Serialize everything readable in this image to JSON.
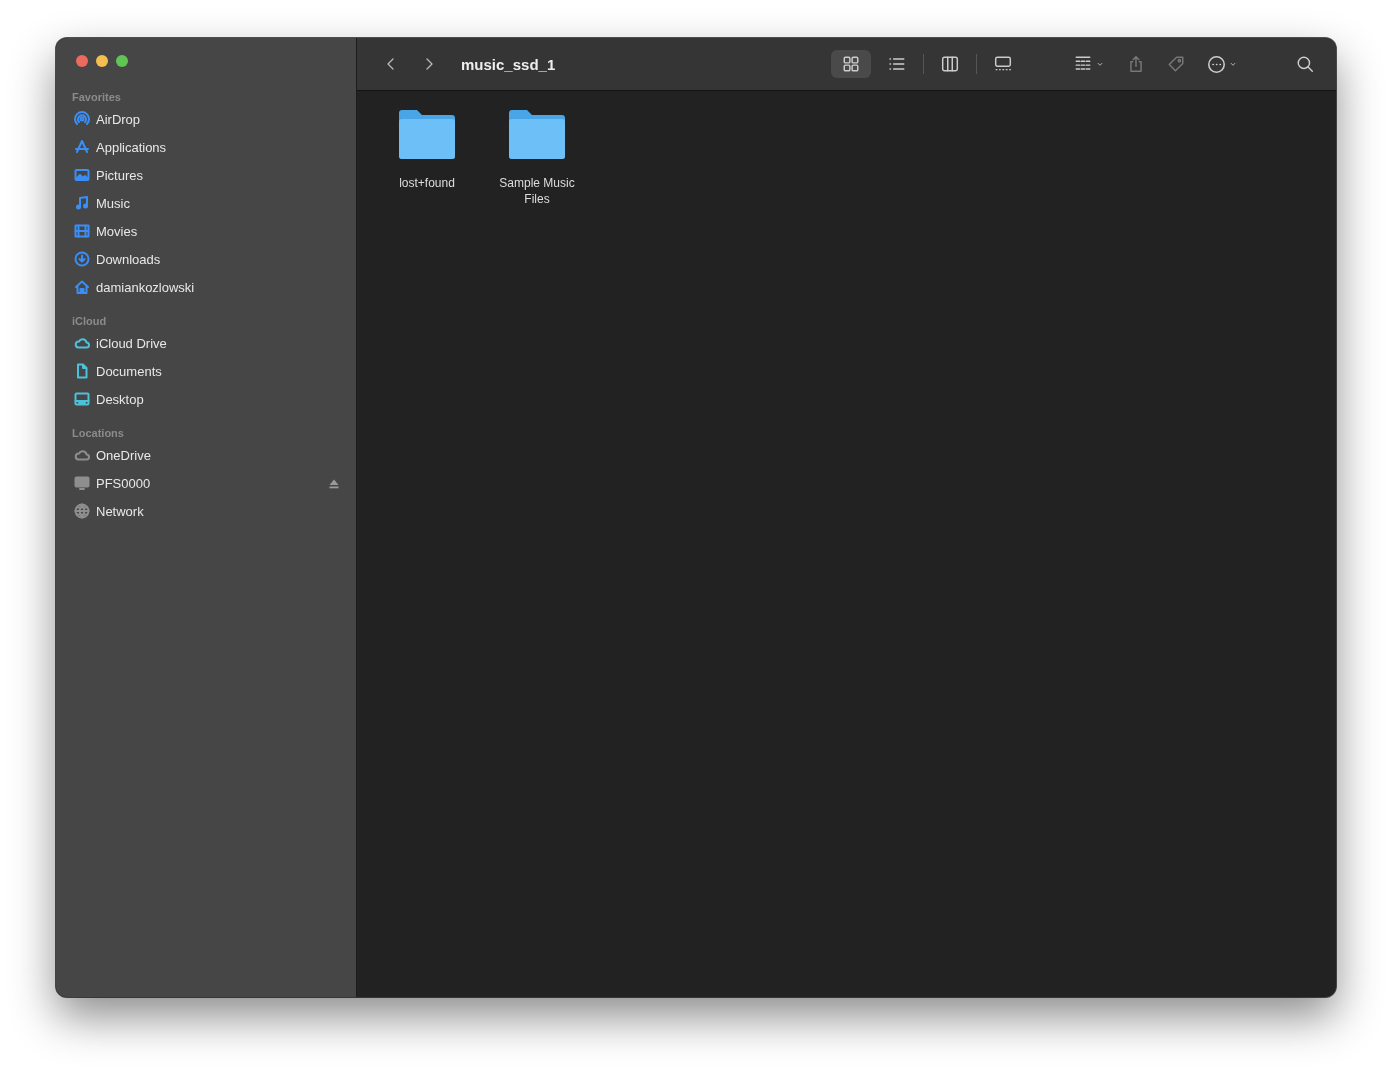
{
  "window": {
    "title": "music_ssd_1"
  },
  "sidebar": {
    "sections": [
      {
        "heading": "Favorites",
        "items": [
          {
            "label": "AirDrop",
            "kind": "airdrop",
            "color": "#3a8ef5"
          },
          {
            "label": "Applications",
            "kind": "apps",
            "color": "#3a8ef5"
          },
          {
            "label": "Pictures",
            "kind": "pictures",
            "color": "#3a8ef5"
          },
          {
            "label": "Music",
            "kind": "music",
            "color": "#3a8ef5"
          },
          {
            "label": "Movies",
            "kind": "movies",
            "color": "#3a8ef5"
          },
          {
            "label": "Downloads",
            "kind": "downloads",
            "color": "#3a8ef5"
          },
          {
            "label": "damiankozlowski",
            "kind": "home",
            "color": "#3a8ef5"
          }
        ]
      },
      {
        "heading": "iCloud",
        "items": [
          {
            "label": "iCloud Drive",
            "kind": "cloud",
            "color": "#4cc2da"
          },
          {
            "label": "Documents",
            "kind": "document",
            "color": "#4cc2da"
          },
          {
            "label": "Desktop",
            "kind": "desktop",
            "color": "#4cc2da"
          }
        ]
      },
      {
        "heading": "Locations",
        "items": [
          {
            "label": "OneDrive",
            "kind": "cloud",
            "color": "#8e8e8e"
          },
          {
            "label": "PFS0000",
            "kind": "display",
            "color": "#8e8e8e",
            "ejectable": true
          },
          {
            "label": "Network",
            "kind": "globe",
            "color": "#8e8e8e"
          }
        ]
      }
    ]
  },
  "toolbar": {
    "views": [
      {
        "kind": "icons",
        "selected": true
      },
      {
        "kind": "list",
        "selected": false
      },
      {
        "kind": "columns",
        "selected": false
      },
      {
        "kind": "gallery",
        "selected": false
      }
    ]
  },
  "files": [
    {
      "name": "lost+found"
    },
    {
      "name": "Sample Music Files"
    }
  ]
}
